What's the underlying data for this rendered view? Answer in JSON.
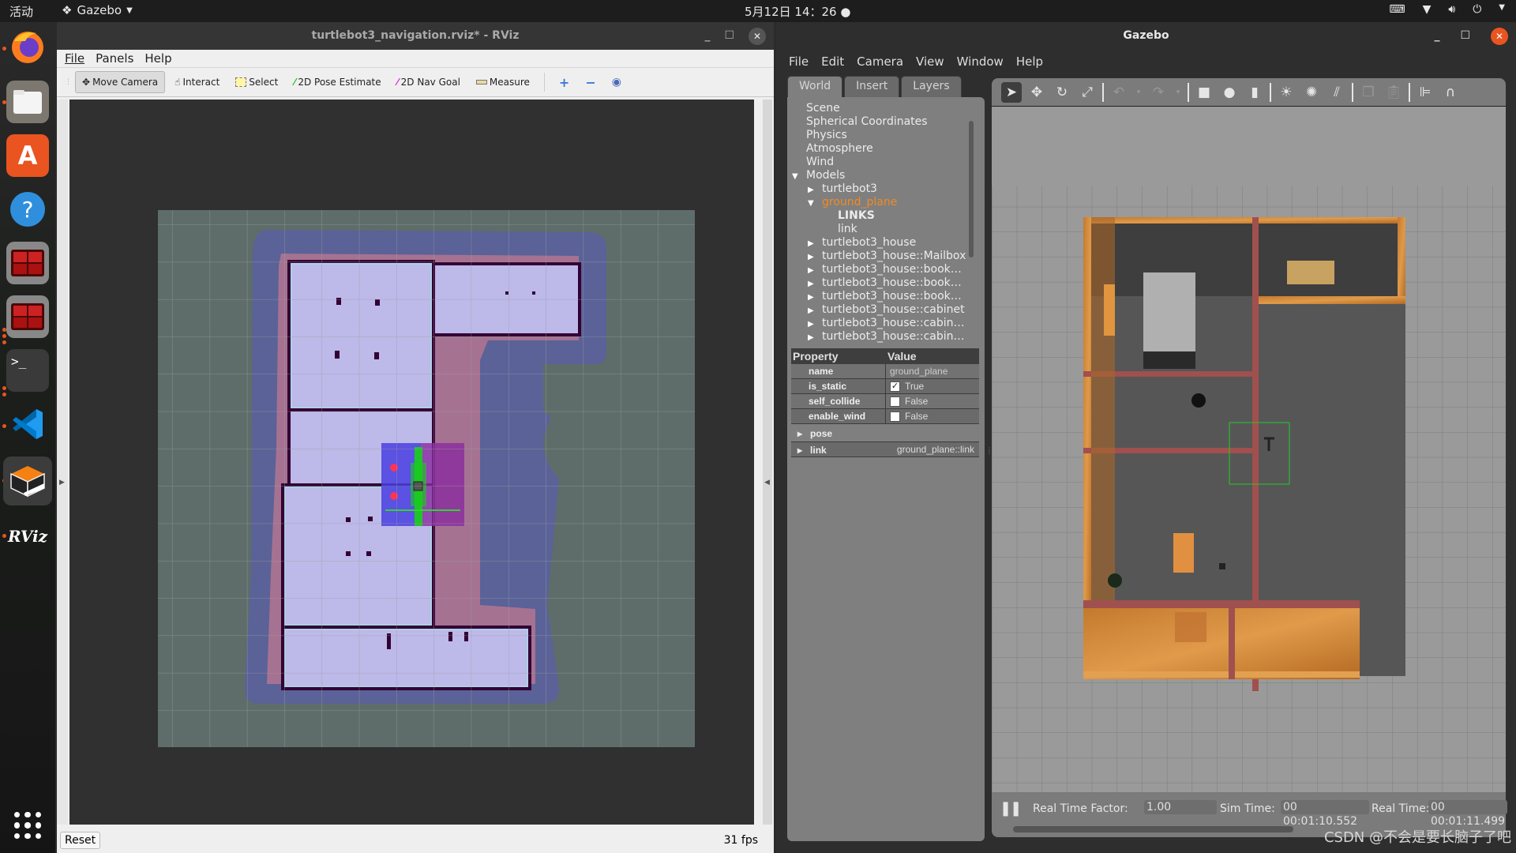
{
  "topbar": {
    "activities": "活动",
    "app_menu": "Gazebo",
    "clock": "5月12日 14：26",
    "tray_icons": [
      "keyboard-icon",
      "wifi-icon",
      "volume-icon",
      "power-icon",
      "chevron-down-icon"
    ]
  },
  "dock": {
    "items": [
      {
        "name": "firefox",
        "running": true
      },
      {
        "name": "files",
        "running": true
      },
      {
        "name": "software-center",
        "running": false
      },
      {
        "name": "help",
        "running": false
      },
      {
        "name": "terminator",
        "running": false
      },
      {
        "name": "terminator-2",
        "running": true
      },
      {
        "name": "terminal",
        "running": true
      },
      {
        "name": "vscode",
        "running": true
      },
      {
        "name": "gazebo",
        "running": true
      },
      {
        "name": "rviz",
        "running": true
      }
    ],
    "rviz_label": "RViz",
    "show_apps": "show-apps-icon"
  },
  "rviz": {
    "title": "turtlebot3_navigation.rviz* - RViz",
    "menu": [
      "File",
      "Panels",
      "Help"
    ],
    "tools": [
      {
        "label": "Move Camera",
        "icon": "move-camera-icon",
        "active": true
      },
      {
        "label": "Interact",
        "icon": "hand-icon",
        "active": false
      },
      {
        "label": "Select",
        "icon": "select-icon",
        "active": false
      },
      {
        "label": "2D Pose Estimate",
        "icon": "pose-arrow-icon",
        "active": false
      },
      {
        "label": "2D Nav Goal",
        "icon": "nav-arrow-icon",
        "active": false
      },
      {
        "label": "Measure",
        "icon": "ruler-icon",
        "active": false
      }
    ],
    "colors": {
      "pose_estimate": "#22c020",
      "nav_goal": "#e020d0",
      "plus": "#3a7ad8"
    },
    "reset_label": "Reset",
    "fps": "31 fps"
  },
  "gazebo": {
    "title": "Gazebo",
    "menu": [
      "File",
      "Edit",
      "Camera",
      "View",
      "Window",
      "Help"
    ],
    "tabs": [
      "World",
      "Insert",
      "Layers"
    ],
    "active_tab": "World",
    "tree": [
      {
        "label": "Scene",
        "indent": 0,
        "arrow": ""
      },
      {
        "label": "Spherical Coordinates",
        "indent": 0,
        "arrow": ""
      },
      {
        "label": "Physics",
        "indent": 0,
        "arrow": ""
      },
      {
        "label": "Atmosphere",
        "indent": 0,
        "arrow": ""
      },
      {
        "label": "Wind",
        "indent": 0,
        "arrow": ""
      },
      {
        "label": "Models",
        "indent": 0,
        "arrow": "open"
      },
      {
        "label": "turtlebot3",
        "indent": 1,
        "arrow": "closed"
      },
      {
        "label": "ground_plane",
        "indent": 1,
        "arrow": "open",
        "selected": true
      },
      {
        "label": "LINKS",
        "indent": 2,
        "arrow": "",
        "bold": true
      },
      {
        "label": "link",
        "indent": 2,
        "arrow": ""
      },
      {
        "label": "turtlebot3_house",
        "indent": 1,
        "arrow": "closed"
      },
      {
        "label": "turtlebot3_house::Mailbox",
        "indent": 1,
        "arrow": "closed"
      },
      {
        "label": "turtlebot3_house::book…",
        "indent": 1,
        "arrow": "closed"
      },
      {
        "label": "turtlebot3_house::book…",
        "indent": 1,
        "arrow": "closed"
      },
      {
        "label": "turtlebot3_house::book…",
        "indent": 1,
        "arrow": "closed"
      },
      {
        "label": "turtlebot3_house::cabinet",
        "indent": 1,
        "arrow": "closed"
      },
      {
        "label": "turtlebot3_house::cabin…",
        "indent": 1,
        "arrow": "closed"
      },
      {
        "label": "turtlebot3_house::cabin…",
        "indent": 1,
        "arrow": "closed"
      }
    ],
    "properties": {
      "header": {
        "property": "Property",
        "value": "Value"
      },
      "rows": [
        {
          "key": "name",
          "value": "ground_plane",
          "checkbox": null
        },
        {
          "key": "is_static",
          "value": "True",
          "checkbox": true
        },
        {
          "key": "self_collide",
          "value": "False",
          "checkbox": false
        },
        {
          "key": "enable_wind",
          "value": "False",
          "checkbox": false
        }
      ],
      "groups": [
        {
          "key": "pose",
          "value": ""
        },
        {
          "key": "link",
          "value": "ground_plane::link"
        }
      ]
    },
    "toolbar_icons": [
      "select-arrow-icon",
      "translate-icon",
      "rotate-icon",
      "scale-icon",
      "undo-icon",
      "redo-icon",
      "box-icon",
      "sphere-icon",
      "cylinder-icon",
      "point-light-icon",
      "spot-light-icon",
      "directional-light-icon",
      "copy-icon",
      "paste-icon",
      "align-icon",
      "magnet-icon"
    ],
    "status": {
      "rtf_label": "Real Time Factor:",
      "rtf_value": "1.00",
      "sim_label": "Sim Time:",
      "sim_value": "00 00:01:10.552",
      "real_label": "Real Time:",
      "real_value": "00 00:01:11.499"
    }
  },
  "watermark": "CSDN @不会是要长脑子了吧"
}
